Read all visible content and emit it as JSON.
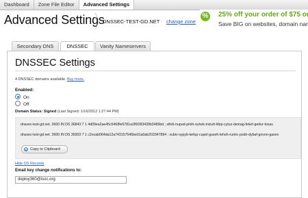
{
  "nav": {
    "items": [
      {
        "label": "Dashboard",
        "active": false
      },
      {
        "label": "Zone File Editor",
        "active": false
      },
      {
        "label": "Advanced Settings",
        "active": true
      }
    ]
  },
  "header": {
    "title": "Advanced Settings",
    "domain": "DNSSEC-TEST-GD.NET",
    "change_zone_label": "change zone"
  },
  "ad": {
    "line1": "25% off your order of $75 or mo",
    "line2": "Save BIG on websites, domain nan",
    "accent_color": "#6aa31f"
  },
  "tabs": [
    {
      "label": "Secondary DNS",
      "active": false
    },
    {
      "label": "DNSSEC",
      "active": true
    },
    {
      "label": "Vanity Nameservers",
      "active": false
    }
  ],
  "dnssec": {
    "title": "DNSSEC Settings",
    "available_text": "4 DNSSEC domains available.",
    "buy_more_label": "Buy more.",
    "enabled_label": "Enabled:",
    "options": [
      {
        "label": "On",
        "checked": true
      },
      {
        "label": "Off",
        "checked": false
      }
    ],
    "status_label": "Domain Status:",
    "status_value": "Signed",
    "last_signed": "(Last Signed: 1/16/2012 1:27:44 PM)",
    "ds_records": [
      "dnssec-test-gd.net. 3600 IN DS 36843 7 1 4d09ea2ae45c5468fe5781a1f6f283439b3489bd ; xifeb-nupud-pinih-suhek-mizuh-libip-cytuz-demag-fekef-gedur-toxax",
      "dnssec-test-gd.net. 3600 IN DS 39303 7 1 c2ecab064da12a743157545be01a0ab203347894 ; xubiv-sypyb-kefup-cupel-guseh-lehoh-rumic-podir-dybaf-govon-gaxex"
    ],
    "copy_button_label": "Copy to Clipboard",
    "hide_ds_label": "Hide DS Records",
    "email_label": "Email key change notifications to:",
    "email_value": "deploy360@isoc.org"
  }
}
